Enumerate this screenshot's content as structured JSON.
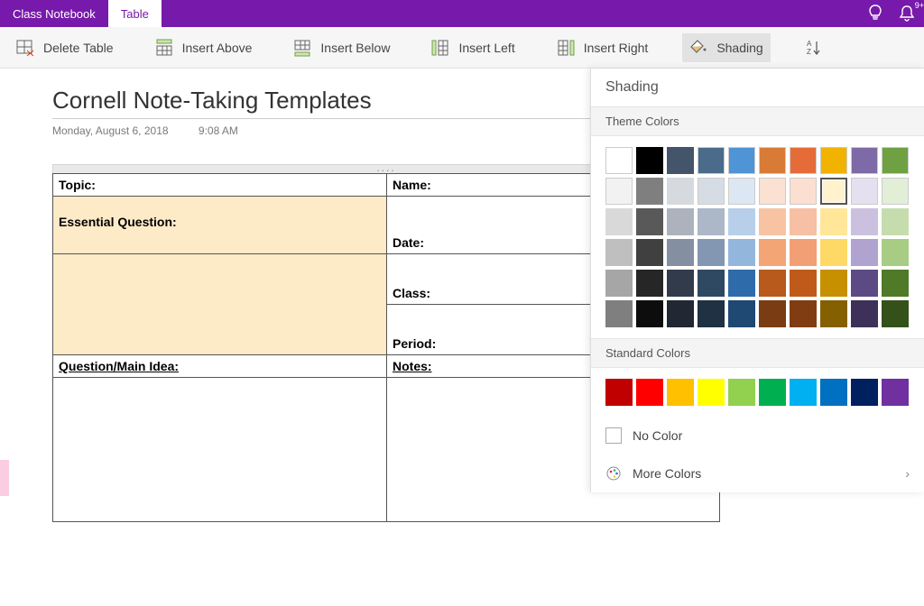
{
  "title_tabs": {
    "class_notebook": "Class Notebook",
    "table": "Table"
  },
  "ribbon": {
    "delete_table": "Delete Table",
    "insert_above": "Insert Above",
    "insert_below": "Insert Below",
    "insert_left": "Insert Left",
    "insert_right": "Insert Right",
    "shading": "Shading"
  },
  "page": {
    "title": "Cornell Note-Taking Templates",
    "date": "Monday, August 6, 2018",
    "time": "9:08 AM"
  },
  "table_labels": {
    "topic": "Topic:",
    "name": "Name:",
    "essential_question": "Essential Question:",
    "date_label": "Date:",
    "class_label": "Class:",
    "period_label": "Period:",
    "question_main": "Question/Main Idea:",
    "notes": "Notes:"
  },
  "panel": {
    "title": "Shading",
    "theme_hdr": "Theme Colors",
    "standard_hdr": "Standard Colors",
    "no_color": "No Color",
    "more_colors": "More Colors"
  },
  "theme_colors": [
    [
      "#ffffff",
      "#000000",
      "#44546a",
      "#4a6b8a",
      "#4f94d4",
      "#d87b36",
      "#e56c39",
      "#f2b200",
      "#7e6aa7",
      "#6fa142"
    ],
    [
      "#f2f2f2",
      "#7f7f7f",
      "#d6d9de",
      "#d5dce4",
      "#dbe7f3",
      "#fbe1d1",
      "#fbdfd1",
      "#fff2cc",
      "#e5e0ef",
      "#e2eed6"
    ],
    [
      "#d9d9d9",
      "#595959",
      "#adb3bd",
      "#acb8c8",
      "#b7cfe8",
      "#f7c3a3",
      "#f7bfa3",
      "#ffe699",
      "#cbc1df",
      "#c5ddad"
    ],
    [
      "#bfbfbf",
      "#404040",
      "#8490a1",
      "#8397b2",
      "#93b7dc",
      "#f3a575",
      "#f39f75",
      "#ffd966",
      "#b1a3cf",
      "#a8cc84"
    ],
    [
      "#a6a6a6",
      "#262626",
      "#323b4b",
      "#2f4962",
      "#2e6bab",
      "#b75a1b",
      "#bf5a1b",
      "#c69000",
      "#5c4a85",
      "#4f7a27"
    ],
    [
      "#7f7f7f",
      "#0d0d0d",
      "#212733",
      "#1f3142",
      "#1f4872",
      "#7a3c12",
      "#803d12",
      "#846000",
      "#3d3159",
      "#35511a"
    ]
  ],
  "selected_theme": {
    "row": 1,
    "col": 7
  },
  "standard_colors": [
    "#c00000",
    "#ff0000",
    "#ffc000",
    "#ffff00",
    "#92d050",
    "#00b050",
    "#00b0f0",
    "#0070c0",
    "#002060",
    "#7030a0"
  ]
}
